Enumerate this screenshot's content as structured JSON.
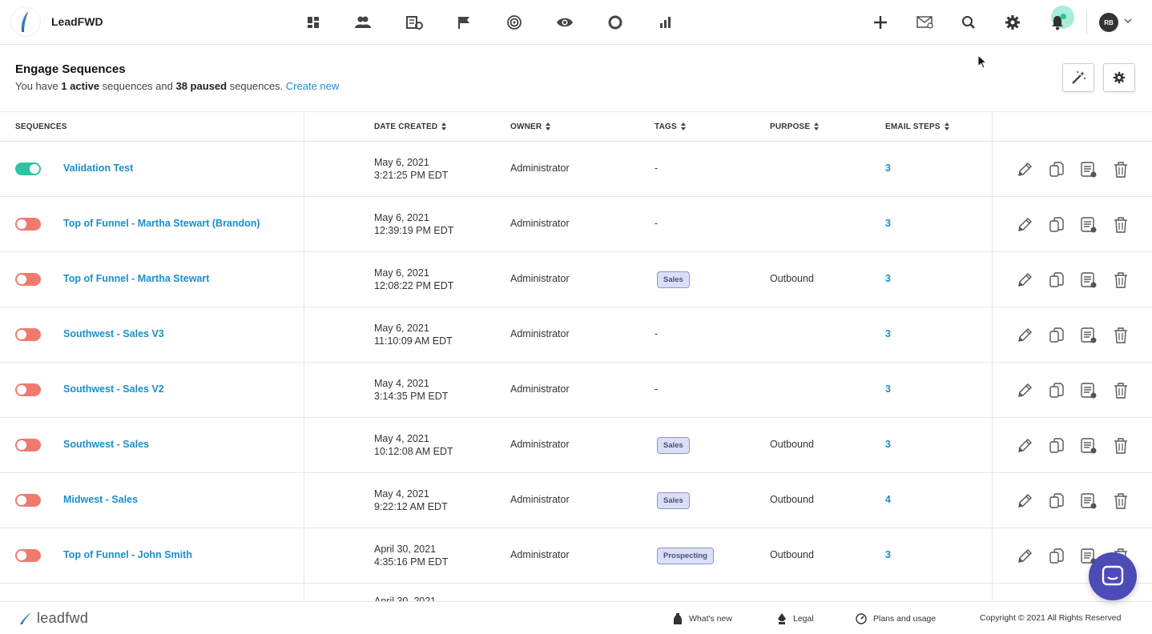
{
  "app": {
    "brand": "LeadFWD",
    "footer_brand": "leadfwd"
  },
  "user": {
    "initials": "RB"
  },
  "nav": [
    {
      "icon": "dashboard-icon"
    },
    {
      "icon": "contacts-icon"
    },
    {
      "icon": "companies-icon"
    },
    {
      "icon": "flag-icon"
    },
    {
      "icon": "target-icon"
    },
    {
      "icon": "eye-icon"
    },
    {
      "icon": "ring-icon"
    },
    {
      "icon": "bar-chart-icon"
    }
  ],
  "header": {
    "title": "Engage Sequences",
    "sub_prefix": "You have ",
    "active_count": "1 active",
    "sub_middle": " sequences and ",
    "paused_count": "38 paused",
    "sub_suffix": " sequences. ",
    "create_label": "Create new"
  },
  "columns": {
    "sequences": "SEQUENCES",
    "date_created": "DATE CREATED",
    "owner": "OWNER",
    "tags": "TAGS",
    "purpose": "PURPOSE",
    "email_steps": "EMAIL STEPS"
  },
  "rows": [
    {
      "active": true,
      "name": "Validation Test",
      "date": "May 6, 2021",
      "time": "3:21:25 PM EDT",
      "owner": "Administrator",
      "tag": "-",
      "tag_badge": "",
      "purpose": "",
      "steps": "3"
    },
    {
      "active": false,
      "name": "Top of Funnel - Martha Stewart (Brandon)",
      "date": "May 6, 2021",
      "time": "12:39:19 PM EDT",
      "owner": "Administrator",
      "tag": "-",
      "tag_badge": "",
      "purpose": "",
      "steps": "3"
    },
    {
      "active": false,
      "name": "Top of Funnel - Martha Stewart",
      "date": "May 6, 2021",
      "time": "12:08:22 PM EDT",
      "owner": "Administrator",
      "tag": "",
      "tag_badge": "Sales",
      "purpose": "Outbound",
      "steps": "3"
    },
    {
      "active": false,
      "name": "Southwest - Sales V3",
      "date": "May 6, 2021",
      "time": "11:10:09 AM EDT",
      "owner": "Administrator",
      "tag": "-",
      "tag_badge": "",
      "purpose": "",
      "steps": "3"
    },
    {
      "active": false,
      "name": "Southwest - Sales V2",
      "date": "May 4, 2021",
      "time": "3:14:35 PM EDT",
      "owner": "Administrator",
      "tag": "-",
      "tag_badge": "",
      "purpose": "",
      "steps": "3"
    },
    {
      "active": false,
      "name": "Southwest - Sales",
      "date": "May 4, 2021",
      "time": "10:12:08 AM EDT",
      "owner": "Administrator",
      "tag": "",
      "tag_badge": "Sales",
      "purpose": "Outbound",
      "steps": "3"
    },
    {
      "active": false,
      "name": "Midwest - Sales",
      "date": "May 4, 2021",
      "time": "9:22:12 AM EDT",
      "owner": "Administrator",
      "tag": "",
      "tag_badge": "Sales",
      "purpose": "Outbound",
      "steps": "4"
    },
    {
      "active": false,
      "name": "Top of Funnel - John Smith",
      "date": "April 30, 2021",
      "time": "4:35:16 PM EDT",
      "owner": "Administrator",
      "tag": "",
      "tag_badge": "Prospecting",
      "purpose": "Outbound",
      "steps": "3"
    }
  ],
  "partial_row_date": "April 30, 2021",
  "footer": {
    "whats_new": "What's new",
    "legal": "Legal",
    "plans": "Plans and usage",
    "copyright": "Copyright © 2021 All Rights Reserved"
  },
  "colors": {
    "accent": "#1a8fc9",
    "toggle_on": "#2ec4a0",
    "toggle_off": "#f07a6e",
    "tag_bg": "#dadef7",
    "chat": "#4c4bb8"
  }
}
